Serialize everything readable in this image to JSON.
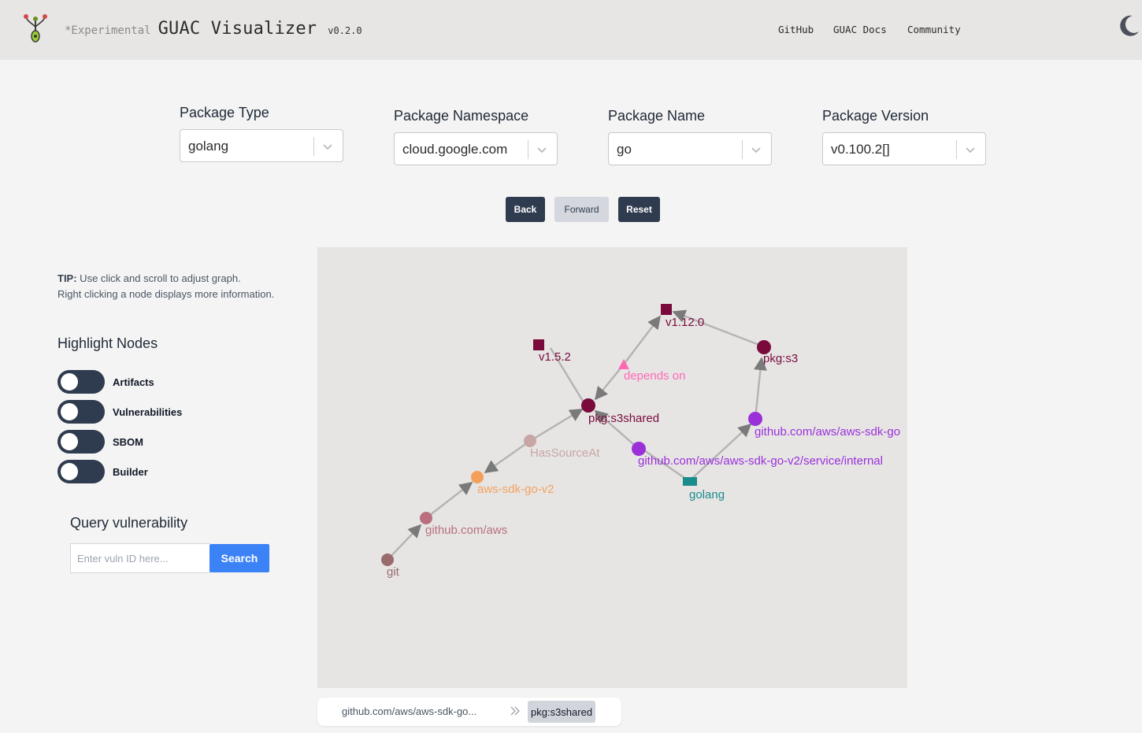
{
  "header": {
    "experimental": "*Experimental",
    "title": "GUAC Visualizer",
    "version": "v0.2.0",
    "nav": [
      "GitHub",
      "GUAC Docs",
      "Community"
    ],
    "theme_icon": "moon-icon"
  },
  "filters": {
    "package_type": {
      "label": "Package Type",
      "value": "golang"
    },
    "package_namespace": {
      "label": "Package Namespace",
      "value": "cloud.google.com"
    },
    "package_name": {
      "label": "Package Name",
      "value": "go"
    },
    "package_version": {
      "label": "Package Version",
      "value": "v0.100.2[]"
    }
  },
  "controls": {
    "back": "Back",
    "forward": "Forward",
    "reset": "Reset"
  },
  "sidebar": {
    "tip_bold": "TIP:",
    "tip_line1": " Use click and scroll to adjust graph.",
    "tip_line2": "Right clicking a node displays more information.",
    "highlight_title": "Highlight Nodes",
    "toggles": [
      {
        "label": "Artifacts",
        "on": false
      },
      {
        "label": "Vulnerabilities",
        "on": false
      },
      {
        "label": "SBOM",
        "on": false
      },
      {
        "label": "Builder",
        "on": false
      }
    ],
    "query_title": "Query vulnerability",
    "query_placeholder": "Enter vuln ID here...",
    "search_label": "Search"
  },
  "graph": {
    "colors": {
      "edge": "#b3b3b3",
      "maroon": "#7a0a3c",
      "rose": "#b8707e",
      "pink": "#ff69b4",
      "orange": "#f5a05a",
      "purple": "#9b30d9",
      "teal": "#1a8c8c",
      "light": "#c9a6a6",
      "gitnode": "#9a6b6b"
    },
    "nodes": {
      "v1120": {
        "label": "v1.12.0",
        "shape": "square"
      },
      "v152": {
        "label": "v1.5.2",
        "shape": "square"
      },
      "pkgs3": {
        "label": "pkg:s3",
        "shape": "circle"
      },
      "dependson": {
        "label": "depends on",
        "shape": "triangle"
      },
      "pkgs3shared": {
        "label": "pkg:s3shared",
        "shape": "circle"
      },
      "ghsdk": {
        "label": "github.com/aws/aws-sdk-go",
        "shape": "circle"
      },
      "hassource": {
        "label": "HasSourceAt",
        "shape": "circle"
      },
      "internal": {
        "label": "github.com/aws/aws-sdk-go-v2/service/internal",
        "shape": "circle"
      },
      "golang": {
        "label": "golang",
        "shape": "square"
      },
      "awssdk": {
        "label": "aws-sdk-go-v2",
        "shape": "circle"
      },
      "ghaws": {
        "label": "github.com/aws",
        "shape": "circle"
      },
      "git": {
        "label": "git",
        "shape": "circle"
      }
    }
  },
  "breadcrumb": {
    "first": "github.com/aws/aws-sdk-go...",
    "active": "pkg:s3shared"
  }
}
